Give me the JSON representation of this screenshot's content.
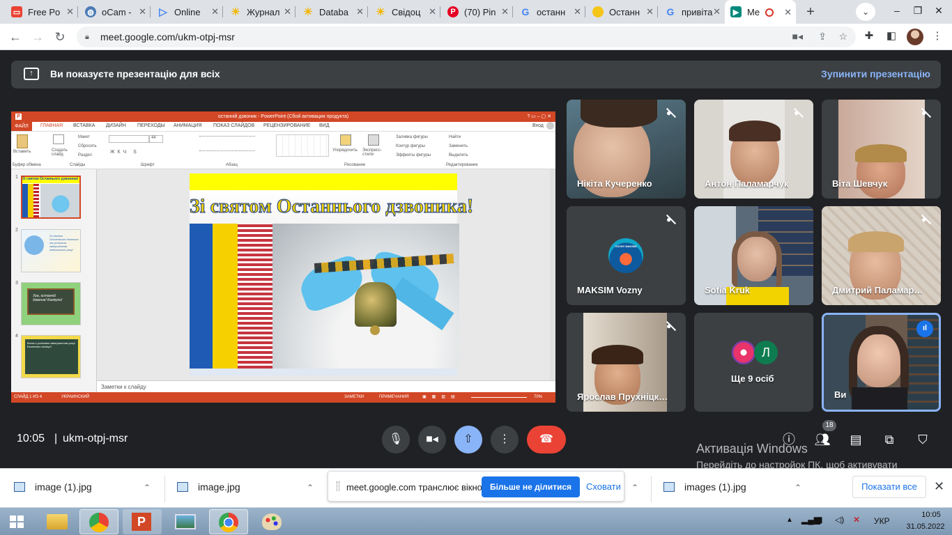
{
  "browser": {
    "tabs": [
      {
        "label": "Free Po",
        "icon": "slides-icon",
        "color": "#ea4335"
      },
      {
        "label": "oCam -",
        "icon": "globe-icon",
        "color": "#4a7ab5"
      },
      {
        "label": "Online",
        "icon": "play-icon",
        "color": "#4285f4"
      },
      {
        "label": "Журнал",
        "icon": "sun-icon",
        "color": "#f2b600"
      },
      {
        "label": "Databa",
        "icon": "sun-icon",
        "color": "#f2b600"
      },
      {
        "label": "Свідоц",
        "icon": "sun-icon",
        "color": "#f2b600"
      },
      {
        "label": "(70) Pin",
        "icon": "pinterest-icon",
        "color": "#e60023"
      },
      {
        "label": "останн",
        "icon": "google-icon",
        "color": "#4285f4"
      },
      {
        "label": "Останн",
        "icon": "circle-icon",
        "color": "#f5c518"
      },
      {
        "label": "привіта",
        "icon": "google-icon",
        "color": "#4285f4"
      },
      {
        "label": "Me",
        "icon": "meet-icon",
        "color": "#00897b"
      }
    ],
    "new_tab": "+",
    "url": "meet.google.com/ukm-otpj-msr"
  },
  "meet": {
    "banner_text": "Ви показуєте презентацію для всіх",
    "stop_label": "Зупинити презентацію",
    "time": "10:05",
    "meeting_code": "ukm-otpj-msr",
    "participants_count": "18",
    "watermark_title": "Активація Windows",
    "watermark_text": "Перейдіть до настройок ПК, щоб активувати Windows."
  },
  "participants": [
    {
      "name": "Нікіта Кучеренко",
      "muted": true
    },
    {
      "name": "Антон Паламарчук",
      "muted": true
    },
    {
      "name": "Віта Шевчук",
      "muted": true
    },
    {
      "name": "MAKSIM Vozny",
      "muted": true,
      "avatar_text": "VOZNY MAKSIM"
    },
    {
      "name": "Sofia Kruk",
      "muted": true
    },
    {
      "name": "Дмитрий Паламар…",
      "muted": true
    },
    {
      "name": "Ярослав Прухніцк…",
      "muted": true
    },
    {
      "name": "Ще 9 осіб",
      "muted": false,
      "avatar_letter": "Л"
    },
    {
      "name": "Ви",
      "muted": false,
      "speaking": true
    }
  ],
  "ppt": {
    "title": "останній дзвоник - PowerPoint (Сбой активации продукта)",
    "signin": "Вход",
    "tabs": [
      "ФАЙЛ",
      "ГЛАВНАЯ",
      "ВСТАВКА",
      "ДИЗАЙН",
      "ПЕРЕХОДЫ",
      "АНИМАЦИЯ",
      "ПОКАЗ СЛАЙДОВ",
      "РЕЦЕНЗИРОВАНИЕ",
      "ВИД"
    ],
    "ribbon": {
      "paste": "Вставить",
      "create": "Создать слайд",
      "layout": "Макет",
      "reset": "Сбросить",
      "section": "Раздел",
      "font_size": "44",
      "arrange": "Упорядочить",
      "quick_styles": "Экспресс-стили",
      "fill": "Заливка фигуры",
      "outline": "Контур фигуры",
      "effects": "Эффекты фигуры",
      "find": "Найти",
      "replace": "Заменить",
      "select": "Выделить",
      "groups": [
        "Буфер обмена",
        "Слайды",
        "Шрифт",
        "Абзац",
        "Рисование",
        "Редактирование"
      ]
    },
    "slide_title": "Зі святом Останнього дзвоника!",
    "thumbs": [
      {
        "num": "1",
        "text": "Зі святом Останнього дзвоника!"
      },
      {
        "num": "2",
        "text": "Зі святом Останнього дзвоника та успішним завершенням навчального року!"
      },
      {
        "num": "3",
        "text": "Ура, останній дзвоник! Канікули!"
      },
      {
        "num": "4",
        "text": "Вітаю з успішним завершенням року! Безпечних канікул!"
      }
    ],
    "notes": "Заметки к слайду",
    "status_left": "СЛАЙД 1 ИЗ 4",
    "status_lang": "УКРАИНСКИЙ",
    "status_notes": "ЗАМЕТКИ",
    "status_comments": "ПРИМЕЧАНИЯ",
    "zoom": "70%"
  },
  "downloads": [
    {
      "name": "image (1).jpg"
    },
    {
      "name": "image.jpg"
    },
    {
      "name": "images (1).jpg"
    }
  ],
  "share_bar": {
    "text": "meet.google.com транслює вікно.",
    "stop": "Більше не ділитися",
    "hide": "Сховати"
  },
  "show_all": "Показати все",
  "taskbar": {
    "lang": "УКР",
    "time": "10:05",
    "date": "31.05.2022"
  },
  "colors": {
    "meet_bg": "#202124",
    "accent_blue": "#8ab4f8",
    "end_call": "#ea4335",
    "present_active": "#8ab4f8",
    "ppt_orange": "#d24726"
  }
}
